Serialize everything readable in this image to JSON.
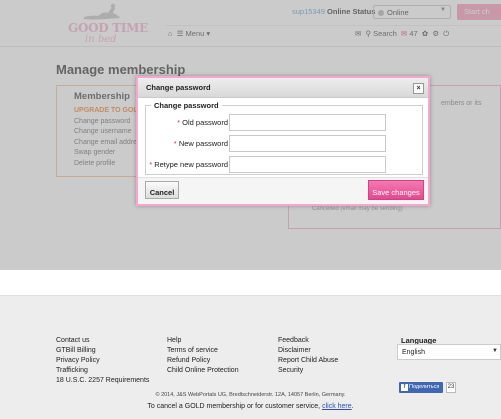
{
  "header": {
    "logo_top": "GOOD TIME",
    "logo_bottom": "in bed",
    "username": "sup15349",
    "online_status_label": "Online Status",
    "online_value": "Online",
    "start_label": "Start ch",
    "menu_label": "Menu",
    "search_label": "Search",
    "messages_count": "47",
    "colors": {
      "brand_pink": "#f2b6cf",
      "accent": "#e64d8e"
    }
  },
  "page": {
    "title": "Manage membership",
    "membership": {
      "heading": "Membership",
      "items": [
        "UPGRADE TO GOLD",
        "Change password",
        "Change username",
        "Change email addre",
        "Swap gender",
        "Delete profile"
      ]
    },
    "right_fragment_1": "embers or its",
    "right_fragment_2": "Cancelled (email may be sending)"
  },
  "modal": {
    "title": "Change password",
    "close_label": "×",
    "fieldset_legend": "Change password",
    "fields": [
      {
        "label": "Old password",
        "value": ""
      },
      {
        "label": "New password",
        "value": ""
      },
      {
        "label": "Retype new password",
        "value": ""
      }
    ],
    "required_mark": "*",
    "cancel_label": "Cancel",
    "save_label": "Save changes"
  },
  "footer": {
    "col1": [
      "Contact us",
      "GTBill Billing",
      "Privacy Policy",
      "Trafficking",
      "18 U.S.C. 2257 Requirements"
    ],
    "col2": [
      "Help",
      "Terms of service",
      "Refund Policy",
      "Child Online Protection"
    ],
    "col3": [
      "Feedback",
      "Disclaimer",
      "Report Child Abuse",
      "Security"
    ],
    "language_title": "Language",
    "language_value": "English",
    "fb_like_label": "Поделиться",
    "fb_count": "23",
    "copyright": "© 2014, J&S WebPortals UG, Bredtschneiderstr. 12A, 14057 Berlin, Germany.",
    "cancel_text": "To cancel a GOLD membership or for customer service,",
    "cancel_link": "click here",
    "cancel_end": "."
  }
}
